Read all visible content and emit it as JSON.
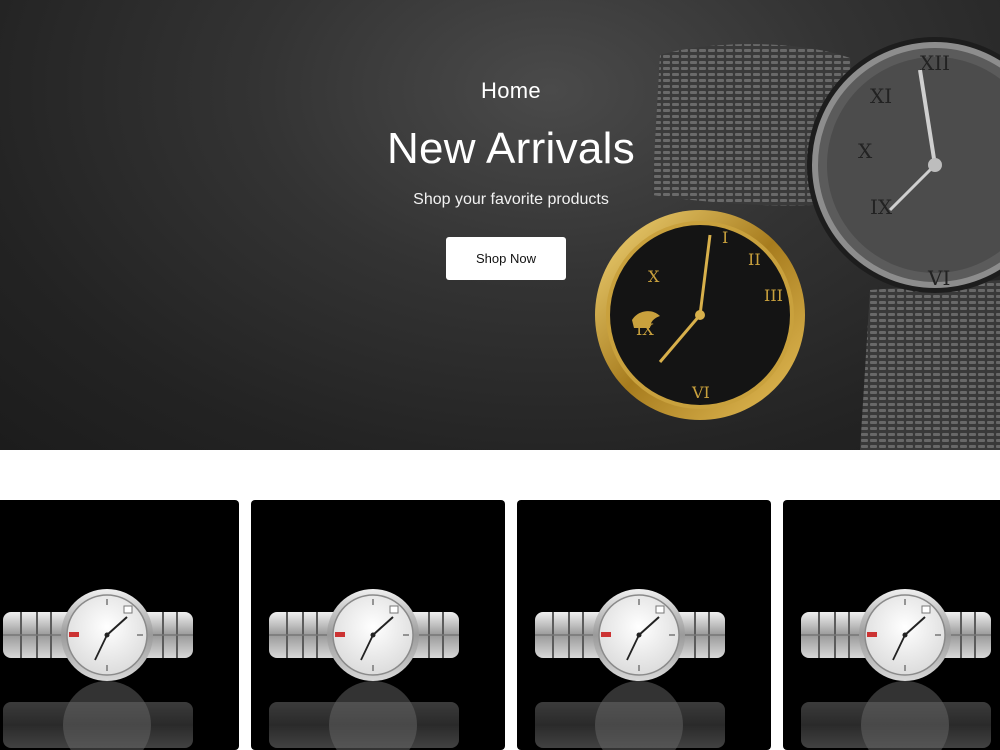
{
  "hero": {
    "breadcrumb": "Home",
    "title": "New Arrivals",
    "subtitle": "Shop your favorite products",
    "cta_label": "Shop Now"
  },
  "products": [
    {
      "image": "silver-watch-product-image"
    },
    {
      "image": "silver-watch-product-image"
    },
    {
      "image": "silver-watch-product-image"
    },
    {
      "image": "silver-watch-product-image"
    }
  ],
  "colors": {
    "hero_background": "#2b2b2b",
    "card_background": "#000000",
    "button_background": "#ffffff"
  }
}
